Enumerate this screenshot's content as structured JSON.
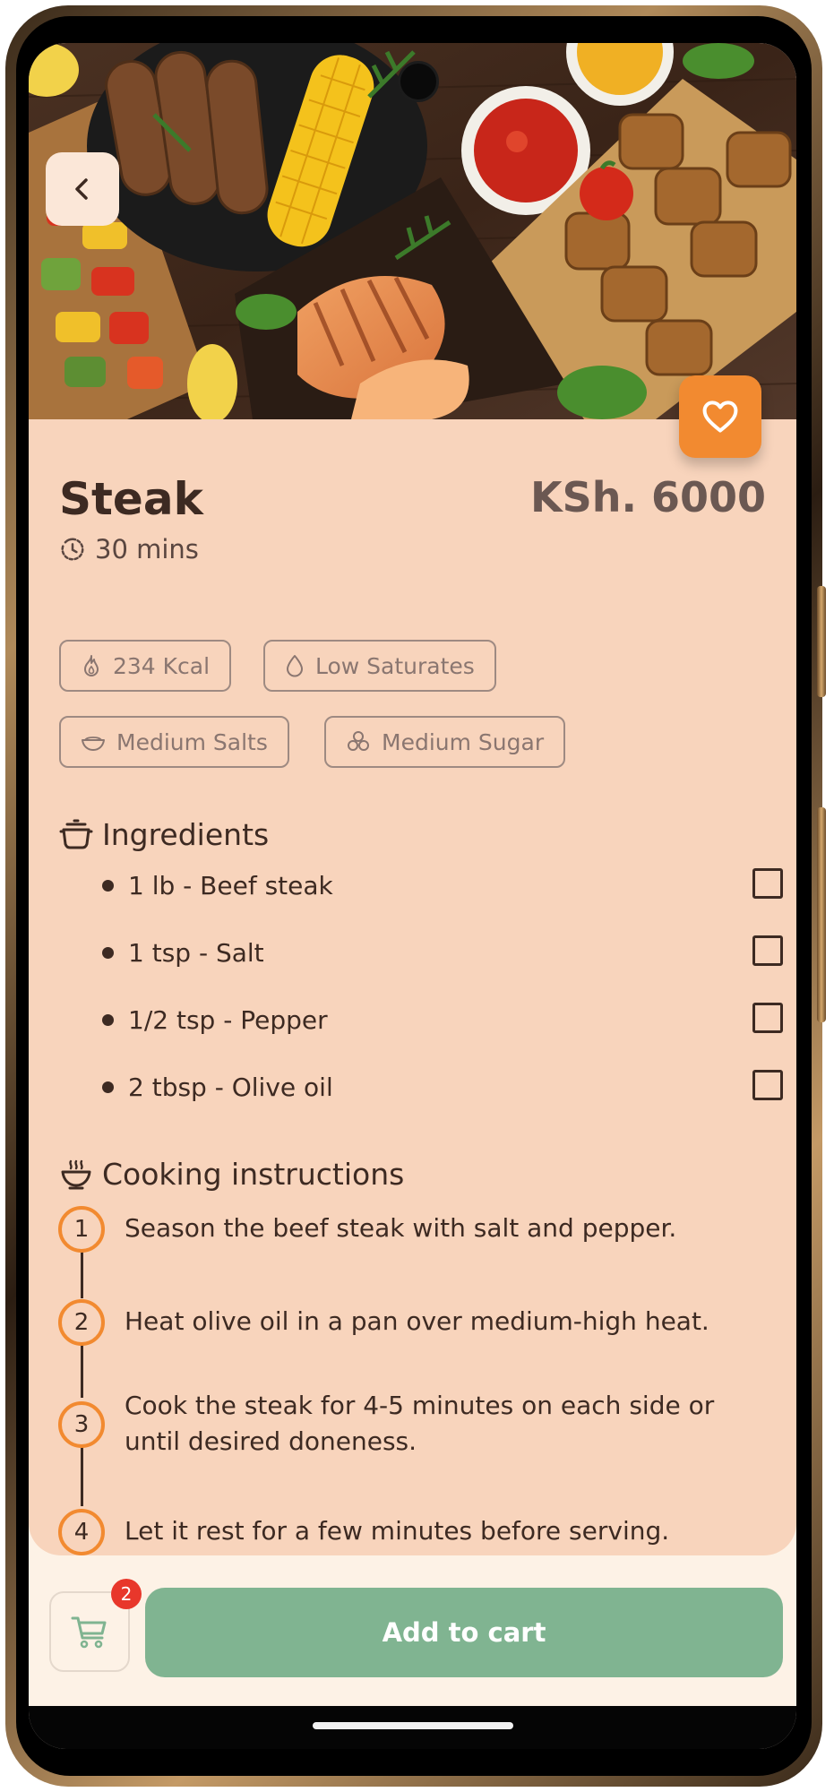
{
  "dish": {
    "name": "Steak",
    "price": "KSh. 6000",
    "time": "30 mins"
  },
  "nutrition_tags": [
    {
      "label": "234 Kcal",
      "icon": "flame-icon"
    },
    {
      "label": "Low Saturates",
      "icon": "droplet-icon"
    },
    {
      "label": "Medium Salts",
      "icon": "salt-bowl-icon"
    },
    {
      "label": "Medium Sugar",
      "icon": "sugar-cubes-icon"
    }
  ],
  "ingredients": {
    "title": "Ingredients",
    "icon": "cooking-pot-icon",
    "items": [
      {
        "text": "1 lb - Beef steak",
        "checked": false
      },
      {
        "text": "1 tsp - Salt",
        "checked": false
      },
      {
        "text": "1/2 tsp - Pepper",
        "checked": false
      },
      {
        "text": "2 tbsp - Olive oil",
        "checked": false
      }
    ]
  },
  "instructions": {
    "title": "Cooking instructions",
    "icon": "steaming-bowl-icon",
    "steps": [
      {
        "number": "1",
        "text": "Season the beef steak with salt and pepper."
      },
      {
        "number": "2",
        "text": "Heat olive oil in a pan over medium-high heat."
      },
      {
        "number": "3",
        "text": "Cook the steak for 4-5 minutes on each side or until desired doneness."
      },
      {
        "number": "4",
        "text": "Let it rest for a few minutes before serving."
      }
    ]
  },
  "actions": {
    "add_to_cart": "Add to cart",
    "cart_count": "2"
  },
  "hero": {
    "image": "grilled-food-spread-photo"
  },
  "colors": {
    "accent": "#f28a30",
    "card_background": "#f8d4bc",
    "primary_button": "#80b491",
    "badge": "#e8372b",
    "text": "#3d2a22"
  }
}
